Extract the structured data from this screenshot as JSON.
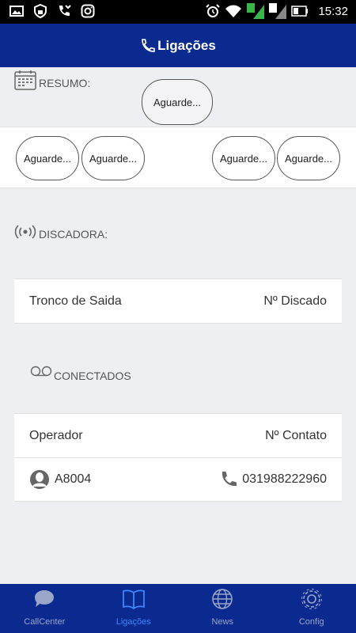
{
  "status_bar": {
    "time": "15:32",
    "sim1": "1",
    "sim2": "2"
  },
  "header": {
    "title": "Ligações"
  },
  "resumo": {
    "label": "RESUMO:",
    "top_pill": "Aguarde...",
    "pills": [
      "Aguarde...",
      "Aguarde...",
      "Aguarde...",
      "Aguarde..."
    ]
  },
  "discadora": {
    "label": "DISCADORA:",
    "col_left": "Tronco de Saida",
    "col_right": "Nº Discado"
  },
  "conectados": {
    "label": "CONECTADOS",
    "col_left": "Operador",
    "col_right": "Nº Contato",
    "rows": [
      {
        "operator": "A8004",
        "contact": "031988222960"
      }
    ]
  },
  "bottom_nav": [
    {
      "label": "CallCenter",
      "icon": "chat-bubble-icon"
    },
    {
      "label": "Ligações",
      "icon": "book-icon"
    },
    {
      "label": "News",
      "icon": "globe-icon"
    },
    {
      "label": "Config",
      "icon": "gear-icon"
    }
  ],
  "colors": {
    "primary": "#0b2a8f",
    "active_tab": "#3d86ff",
    "background": "#eeeff3"
  }
}
